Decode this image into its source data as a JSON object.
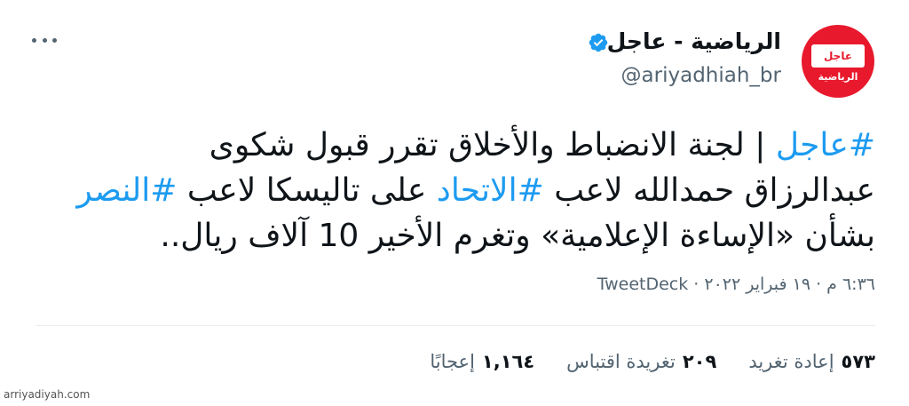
{
  "account": {
    "display_name": "الرياضية - عاجل",
    "handle": "@ariyadhiah_br",
    "avatar_text_top": "عاجل",
    "avatar_text_bottom": "الرياضية"
  },
  "tweet": {
    "line1_hashtag": "#عاجل",
    "line1_text": " | لجنة الانضباط والأخلاق تقرر قبول شكوى",
    "line2_text_a": "عبدالرزاق حمدالله لاعب ",
    "line2_hashtag_a": "#الاتحاد",
    "line2_text_b": " على تاليسكا لاعب ",
    "line2_hashtag_b": "#النصر",
    "line3_text": "بشأن «الإساءة الإعلامية» وتغرم الأخير 10 آلاف ريال.."
  },
  "meta": {
    "time_date": "٦:٣٦ م · ١٩ فبراير ٢٠٢٢ · ",
    "source": "TweetDeck"
  },
  "stats": {
    "retweets_count": "٥٧٣",
    "retweets_label": "إعادة تغريد",
    "quotes_count": "٢٠٩",
    "quotes_label": "تغريدة اقتباس",
    "likes_count": "١,١٦٤",
    "likes_label": "إعجابًا"
  },
  "watermark": "arriyadiyah.com",
  "colors": {
    "accent": "#1d9bf0",
    "avatar_red": "#e8192c",
    "text": "#0f1419",
    "muted": "#536471"
  }
}
